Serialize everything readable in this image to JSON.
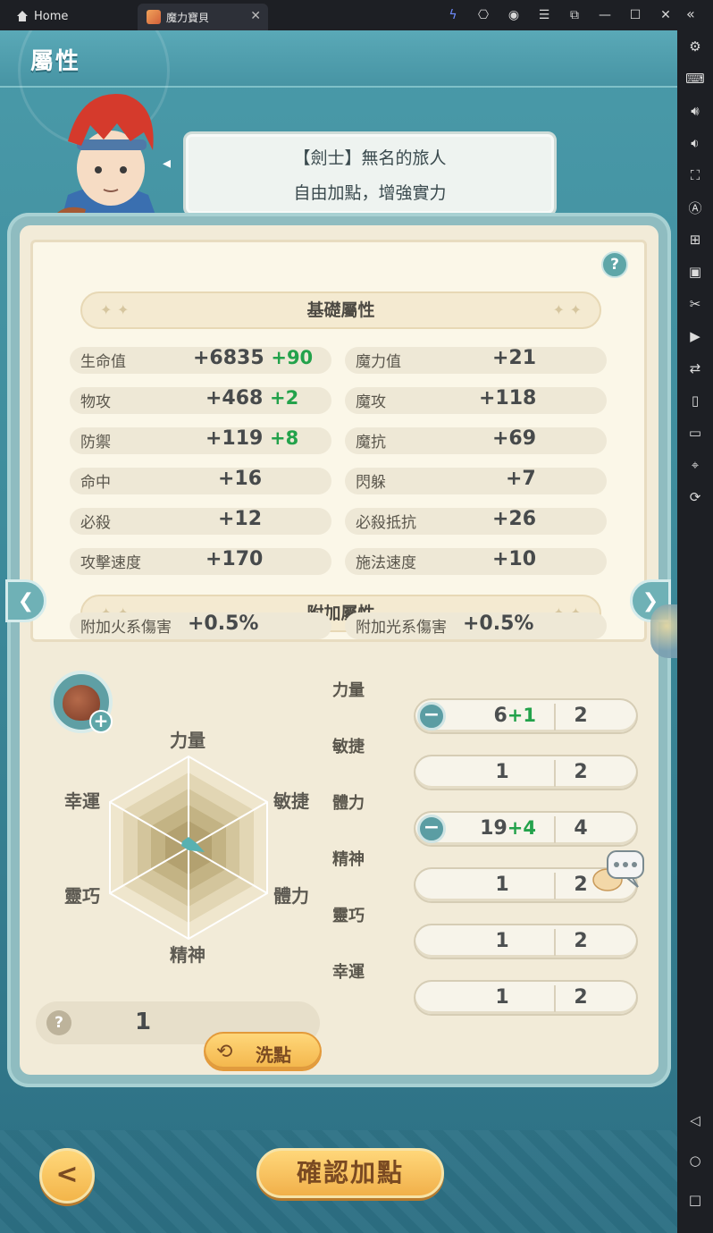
{
  "titlebar": {
    "home_label": "Home",
    "tab_title": "魔力寶貝",
    "icons": [
      "bolt-icon",
      "gamepad-icon",
      "account-icon",
      "menu-icon",
      "window-restore-icon",
      "minimize-icon",
      "maximize-icon",
      "close-icon"
    ],
    "collapse_glyph": "«"
  },
  "sidebar": {
    "icons": [
      "settings-icon",
      "keyboard-icon",
      "volume-up-icon",
      "volume-down-icon",
      "screenshot-icon",
      "macro-icon",
      "add-window-icon",
      "apk-icon",
      "cut-icon",
      "record-icon",
      "sync-icon",
      "shake-icon",
      "folder-icon",
      "location-icon",
      "rotate-icon",
      "back-nav-icon",
      "home-nav-icon",
      "recents-nav-icon"
    ]
  },
  "header": {
    "title": "屬性"
  },
  "bubble": {
    "line1": "【劍士】無名的旅人",
    "line2": "自由加點，增強實力"
  },
  "basic": {
    "title": "基礎屬性",
    "help": "?",
    "stats": [
      {
        "label": "生命值",
        "value": "+6835",
        "bonus": "+90"
      },
      {
        "label": "魔力值",
        "value": "+21",
        "bonus": ""
      },
      {
        "label": "物攻",
        "value": "+468",
        "bonus": "+2"
      },
      {
        "label": "魔攻",
        "value": "+118",
        "bonus": ""
      },
      {
        "label": "防禦",
        "value": "+119",
        "bonus": "+8"
      },
      {
        "label": "魔抗",
        "value": "+69",
        "bonus": ""
      },
      {
        "label": "命中",
        "value": "+16",
        "bonus": ""
      },
      {
        "label": "閃躲",
        "value": "+7",
        "bonus": ""
      },
      {
        "label": "必殺",
        "value": "+12",
        "bonus": ""
      },
      {
        "label": "必殺抵抗",
        "value": "+26",
        "bonus": ""
      },
      {
        "label": "攻擊速度",
        "value": "+170",
        "bonus": ""
      },
      {
        "label": "施法速度",
        "value": "+10",
        "bonus": ""
      }
    ]
  },
  "extra": {
    "title": "附加屬性",
    "stats": [
      {
        "label": "附加火系傷害",
        "value": "+0.5%"
      },
      {
        "label": "附加光系傷害",
        "value": "+0.5%"
      }
    ]
  },
  "radar": {
    "labels": [
      "力量",
      "敏捷",
      "體力",
      "精神",
      "靈巧",
      "幸運"
    ]
  },
  "allocation": {
    "rows": [
      {
        "label": "力量",
        "current": "6",
        "bonus": "+1",
        "max": "2",
        "has_minus": true
      },
      {
        "label": "敏捷",
        "current": "1",
        "bonus": "",
        "max": "2",
        "has_minus": false
      },
      {
        "label": "體力",
        "current": "19",
        "bonus": "+4",
        "max": "4",
        "has_minus": true
      },
      {
        "label": "精神",
        "current": "1",
        "bonus": "",
        "max": "2",
        "has_minus": false
      },
      {
        "label": "靈巧",
        "current": "1",
        "bonus": "",
        "max": "2",
        "has_minus": false
      },
      {
        "label": "幸運",
        "current": "1",
        "bonus": "",
        "max": "2",
        "has_minus": false
      }
    ]
  },
  "reset": {
    "help": "?",
    "points": "1",
    "button_label": "洗點"
  },
  "footer": {
    "back_glyph": "<",
    "confirm_label": "確認加點"
  },
  "colors": {
    "bonus_green": "#23a24b",
    "accent_gold": "#f3b54a",
    "teal": "#4a9aa9",
    "panel_cream": "#fbf7e8"
  }
}
